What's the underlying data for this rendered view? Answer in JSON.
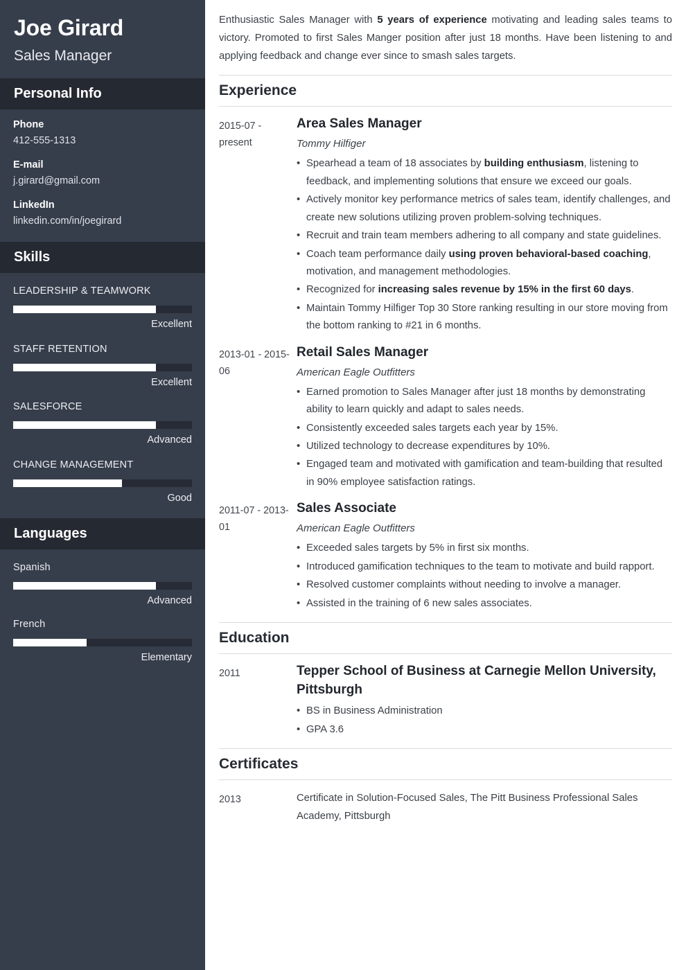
{
  "sidebar": {
    "name": "Joe Girard",
    "job_title": "Sales Manager",
    "personal_info": {
      "heading": "Personal Info",
      "items": [
        {
          "label": "Phone",
          "value": "412-555-1313"
        },
        {
          "label": "E-mail",
          "value": "j.girard@gmail.com"
        },
        {
          "label": "LinkedIn",
          "value": "linkedin.com/in/joegirard"
        }
      ]
    },
    "skills": {
      "heading": "Skills",
      "items": [
        {
          "name": "LEADERSHIP & TEAMWORK",
          "rating": "Excellent",
          "level": 80
        },
        {
          "name": "STAFF RETENTION",
          "rating": "Excellent",
          "level": 80
        },
        {
          "name": "SALESFORCE",
          "rating": "Advanced",
          "level": 80
        },
        {
          "name": "CHANGE MANAGEMENT",
          "rating": "Good",
          "level": 61
        }
      ]
    },
    "languages": {
      "heading": "Languages",
      "items": [
        {
          "name": "Spanish",
          "rating": "Advanced",
          "level": 80
        },
        {
          "name": "French",
          "rating": "Elementary",
          "level": 41
        }
      ]
    }
  },
  "main": {
    "summary": {
      "part1": "Enthusiastic Sales Manager with ",
      "bold1": "5 years of experience",
      "part2": " motivating and leading sales teams to victory. Promoted to first Sales Manger position after just 18 months. Have been listening to and applying feedback and change ever since to smash sales targets."
    },
    "experience": {
      "heading": "Experience",
      "entries": [
        {
          "date": "2015-07 - present",
          "role": "Area Sales Manager",
          "org": "Tommy Hilfiger",
          "bullets": [
            {
              "part1": "Spearhead a team of 18 associates by ",
              "bold": "building enthusiasm",
              "part2": ", listening to feedback, and implementing solutions that ensure we exceed our goals."
            },
            {
              "part1": "Actively monitor key performance metrics of sales team, identify challenges, and create new solutions utilizing proven problem-solving techniques.",
              "bold": "",
              "part2": ""
            },
            {
              "part1": "Recruit and train team members adhering to all company and state guidelines.",
              "bold": "",
              "part2": ""
            },
            {
              "part1": "Coach team performance daily ",
              "bold": "using proven behavioral-based coaching",
              "part2": ", motivation, and management methodologies."
            },
            {
              "part1": "Recognized for ",
              "bold": "increasing sales revenue by 15% in the first 60 days",
              "part2": "."
            },
            {
              "part1": "Maintain Tommy Hilfiger Top 30 Store ranking resulting in our store moving from the bottom ranking to #21 in 6 months.",
              "bold": "",
              "part2": ""
            }
          ]
        },
        {
          "date": "2013-01 - 2015-06",
          "role": "Retail Sales Manager",
          "org": "American Eagle Outfitters",
          "bullets": [
            {
              "part1": "Earned promotion to Sales Manager after just 18 months by demonstrating ability to learn quickly and adapt to sales needs.",
              "bold": "",
              "part2": ""
            },
            {
              "part1": "Consistently exceeded sales targets each year by 15%.",
              "bold": "",
              "part2": ""
            },
            {
              "part1": "Utilized technology to decrease expenditures by 10%.",
              "bold": "",
              "part2": ""
            },
            {
              "part1": "Engaged team and motivated with gamification and team-building that resulted in 90% employee satisfaction ratings.",
              "bold": "",
              "part2": ""
            }
          ]
        },
        {
          "date": "2011-07 - 2013-01",
          "role": "Sales Associate",
          "org": "American Eagle Outfitters",
          "bullets": [
            {
              "part1": "Exceeded sales targets by 5% in first six months.",
              "bold": "",
              "part2": ""
            },
            {
              "part1": "Introduced gamification techniques to the team to motivate and build rapport.",
              "bold": "",
              "part2": ""
            },
            {
              "part1": "Resolved customer complaints without needing to involve a manager.",
              "bold": "",
              "part2": ""
            },
            {
              "part1": "Assisted in the training of 6 new sales associates.",
              "bold": "",
              "part2": ""
            }
          ]
        }
      ]
    },
    "education": {
      "heading": "Education",
      "entries": [
        {
          "date": "2011",
          "school": "Tepper School of Business at Carnegie Mellon University, Pittsburgh",
          "bullets": [
            "BS in Business Administration",
            "GPA 3.6"
          ]
        }
      ]
    },
    "certificates": {
      "heading": "Certificates",
      "entries": [
        {
          "date": "2013",
          "text": "Certificate in Solution-Focused Sales, The Pitt Business Professional Sales Academy, Pittsburgh"
        }
      ]
    }
  }
}
